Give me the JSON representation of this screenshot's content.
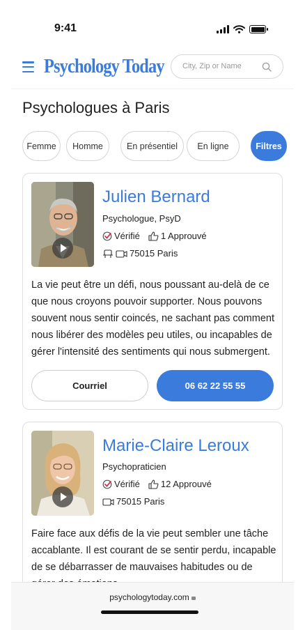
{
  "status_bar": {
    "time": "9:41"
  },
  "header": {
    "logo": "Psychology Today",
    "search_placeholder": "City, Zip or Name"
  },
  "page_title": "Psychologues à Paris",
  "filters": [
    {
      "label": "Femme",
      "active": false
    },
    {
      "label": "Homme",
      "active": false
    },
    {
      "label": "En présentiel",
      "active": false
    },
    {
      "label": "En ligne",
      "active": false
    },
    {
      "label": "Filtres",
      "active": true
    }
  ],
  "profiles": [
    {
      "name": "Julien Bernard",
      "title": "Psychologue, PsyD",
      "verified": "Vérifié",
      "approvals": "1 Approuvé",
      "location": "75015 Paris",
      "description": "La vie peut être un défi, nous poussant au-delà de ce que nous croyons pouvoir supporter. Nous pouvons souvent nous sentir coincés, ne sachant pas comment nous libérer des modèles peu utiles, ou incapables de gérer l'intensité des sentiments qui nous submergent.",
      "email_label": "Courriel",
      "phone": "06 62 22 55 55"
    },
    {
      "name": "Marie-Claire Leroux",
      "title": "Psychopraticien",
      "verified": "Vérifié",
      "approvals": "12 Approuvé",
      "location": "75015 Paris",
      "description": "Faire face aux défis de la vie peut sembler une tâche accablante. Il est courant de se sentir perdu, incapable de se débarrasser de mauvaises habitudes ou de gérer des émotions"
    }
  ],
  "browser": {
    "url": "psychologytoday.com"
  },
  "colors": {
    "accent": "#3a7bdc",
    "border": "#dedede",
    "verified_check": "#d9334a"
  }
}
